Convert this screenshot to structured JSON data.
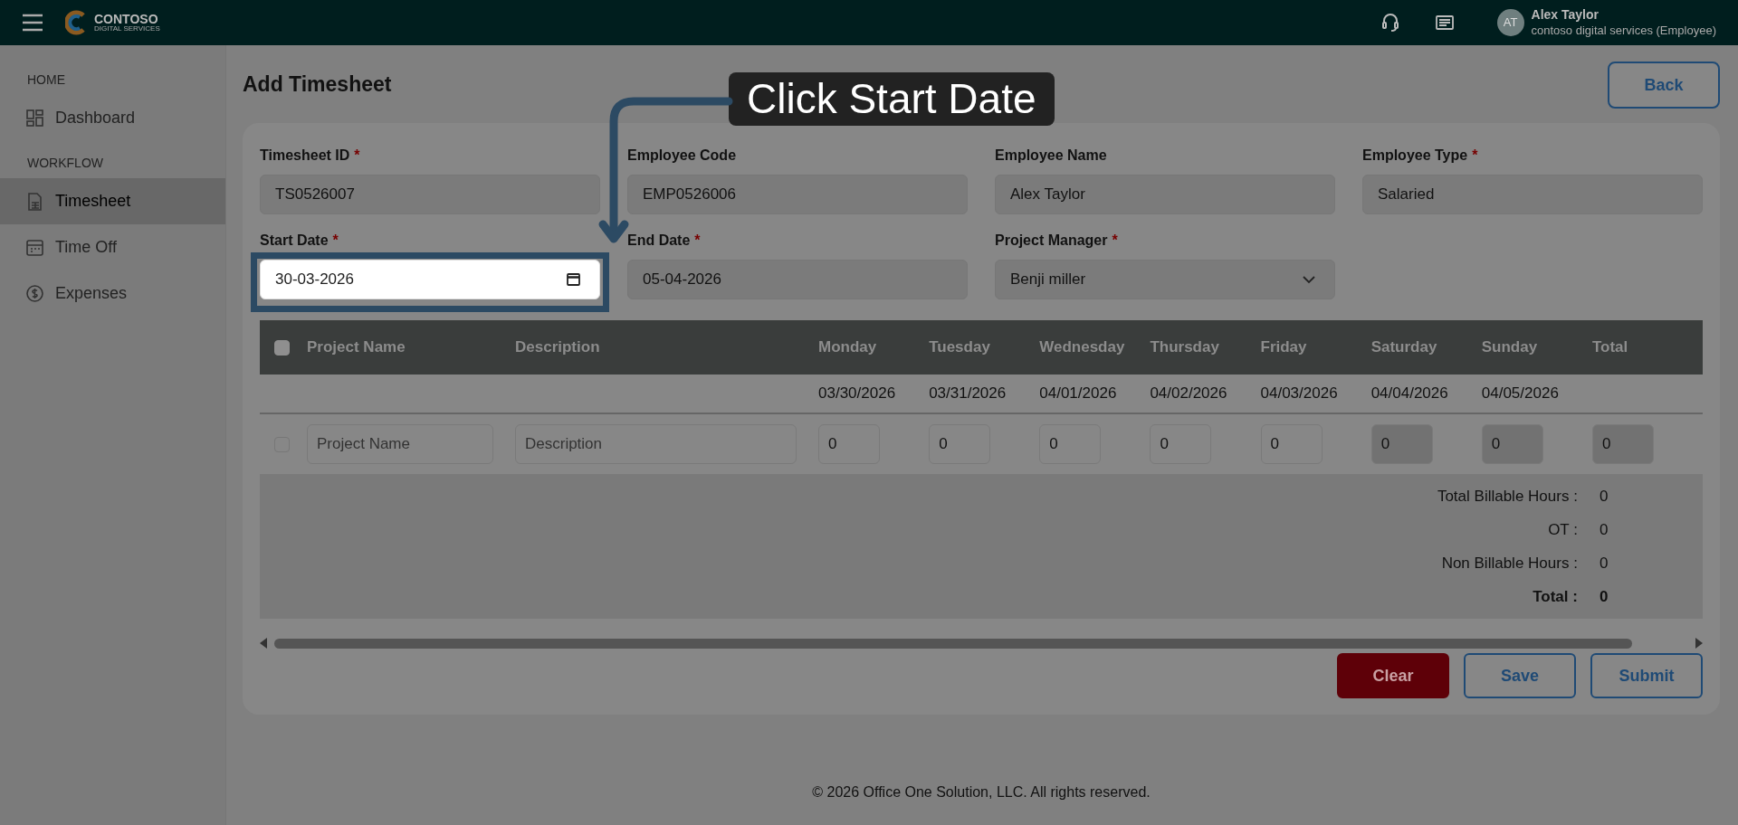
{
  "header": {
    "logo_text": "CONTOSO",
    "logo_subtext": "DIGITAL SERVICES",
    "user": {
      "initials": "AT",
      "name": "Alex Taylor",
      "org": "contoso digital services (Employee)"
    }
  },
  "sidebar": {
    "sections": [
      {
        "heading": "HOME",
        "items": [
          {
            "label": "Dashboard",
            "kind": "dashboard",
            "selected": false
          }
        ]
      },
      {
        "heading": "WORKFLOW",
        "items": [
          {
            "label": "Timesheet",
            "kind": "timesheet",
            "selected": true
          },
          {
            "label": "Time Off",
            "kind": "timeoff",
            "selected": false
          },
          {
            "label": "Expenses",
            "kind": "expenses",
            "selected": false
          }
        ]
      }
    ]
  },
  "page": {
    "title": "Add Timesheet",
    "back_button": "Back"
  },
  "fields": [
    {
      "label": "Timesheet ID",
      "required_mark": "*",
      "value": "TS0526007",
      "kind": "text",
      "highlighted": false
    },
    {
      "label": "Employee Code",
      "value": "EMP0526006",
      "kind": "text",
      "highlighted": false
    },
    {
      "label": "Employee Name",
      "value": "Alex Taylor",
      "kind": "text",
      "highlighted": false
    },
    {
      "label": "Employee Type",
      "required_mark": "*",
      "value": "Salaried",
      "kind": "text",
      "highlighted": false
    },
    {
      "label": "Start Date",
      "required_mark": "*",
      "value": "30-03-2026",
      "kind": "date",
      "highlighted": true
    },
    {
      "label": "End Date",
      "required_mark": "*",
      "value": "05-04-2026",
      "kind": "text",
      "highlighted": false
    },
    {
      "label": "Project Manager",
      "required_mark": "*",
      "value": "Benji miller",
      "kind": "select",
      "highlighted": false
    }
  ],
  "table": {
    "select_all_checked": false,
    "columns": [
      {
        "label": "Project Name"
      },
      {
        "label": "Description"
      },
      {
        "label": "Monday",
        "date": "03/30/2026"
      },
      {
        "label": "Tuesday",
        "date": "03/31/2026"
      },
      {
        "label": "Wednesday",
        "date": "04/01/2026"
      },
      {
        "label": "Thursday",
        "date": "04/02/2026"
      },
      {
        "label": "Friday",
        "date": "04/03/2026"
      },
      {
        "label": "Saturday",
        "date": "04/04/2026"
      },
      {
        "label": "Sunday",
        "date": "04/05/2026"
      },
      {
        "label": "Total"
      }
    ],
    "rows": [
      {
        "checked": false,
        "project_placeholder": "Project Name",
        "description_placeholder": "Description",
        "hours": [
          {
            "value": "0",
            "disabled": false
          },
          {
            "value": "0",
            "disabled": false
          },
          {
            "value": "0",
            "disabled": false
          },
          {
            "value": "0",
            "disabled": false
          },
          {
            "value": "0",
            "disabled": false
          },
          {
            "value": "0",
            "disabled": true
          },
          {
            "value": "0",
            "disabled": true
          }
        ],
        "total": "0"
      }
    ],
    "summary": [
      {
        "label": "Total Billable Hours :",
        "value": "0",
        "kind": "normal"
      },
      {
        "label": "OT :",
        "value": "0",
        "kind": "normal"
      },
      {
        "label": "Non Billable Hours :",
        "value": "0",
        "kind": "normal"
      },
      {
        "label": "Total :",
        "value": "0",
        "kind": "grand"
      }
    ]
  },
  "buttons": [
    {
      "label": "Clear",
      "kind": "danger"
    },
    {
      "label": "Save",
      "kind": "outline"
    },
    {
      "label": "Submit",
      "kind": "outline"
    }
  ],
  "guide": {
    "text": "Click Start Date"
  },
  "footer": "© 2026 Office One Solution, LLC. All rights reserved."
}
